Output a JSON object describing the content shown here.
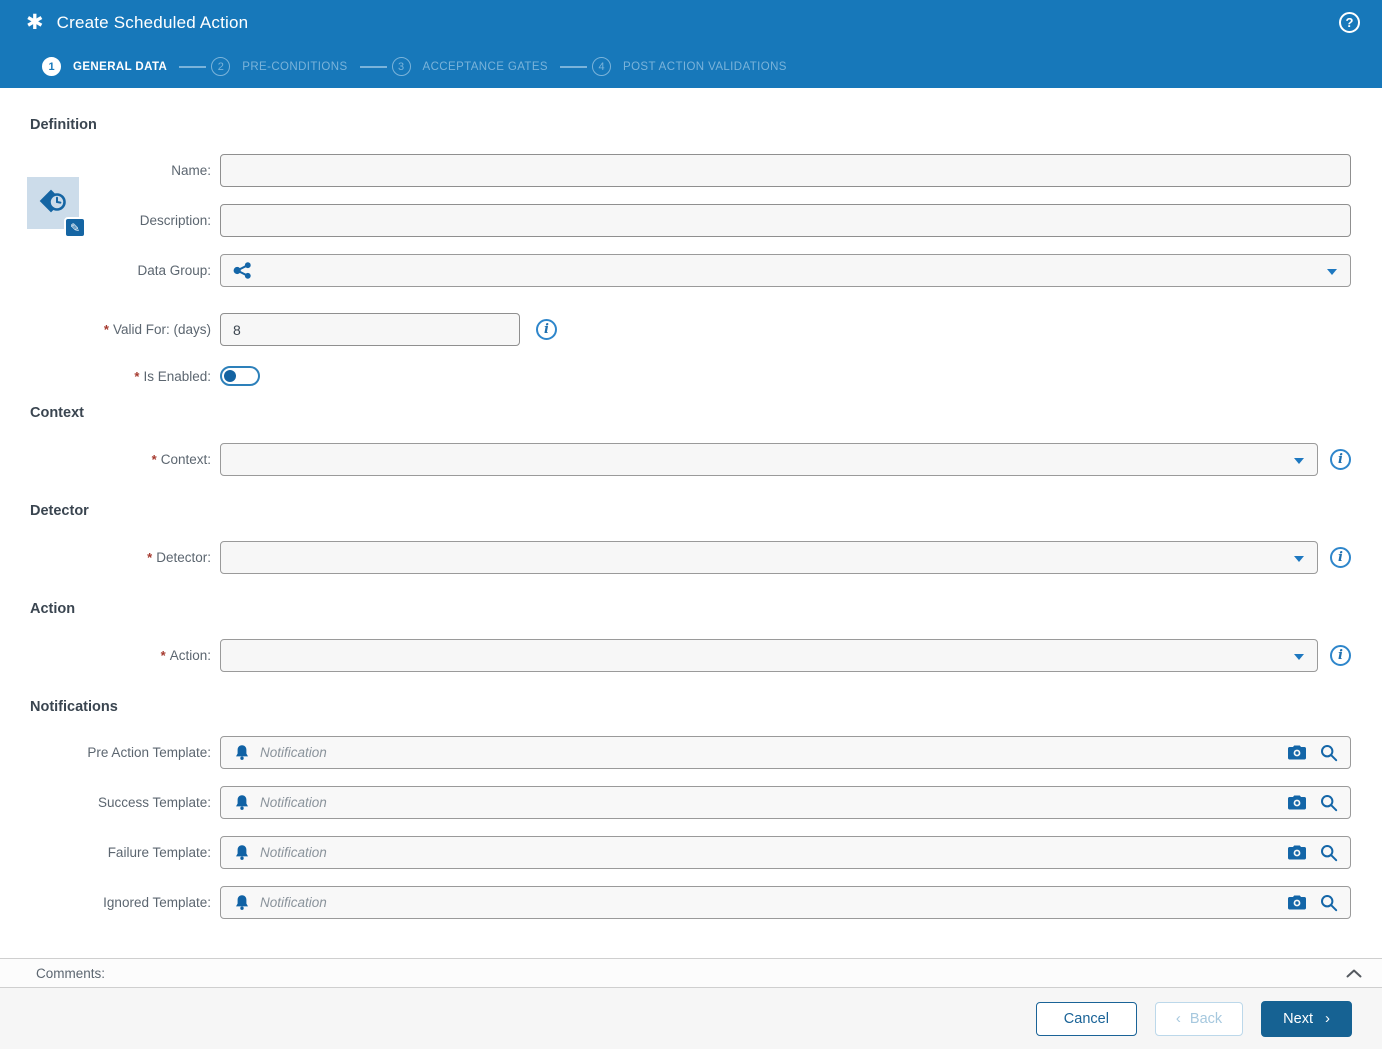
{
  "required_marker": "*",
  "header": {
    "app_icon_glyph": "✱",
    "title": "Create Scheduled Action",
    "help_glyph": "?"
  },
  "stepper": {
    "steps": [
      {
        "number": "1",
        "label": "GENERAL DATA"
      },
      {
        "number": "2",
        "label": "PRE-CONDITIONS"
      },
      {
        "number": "3",
        "label": "ACCEPTANCE GATES"
      },
      {
        "number": "4",
        "label": "POST ACTION VALIDATIONS"
      }
    ]
  },
  "definition": {
    "heading": "Definition",
    "name_label": "Name:",
    "name_value": "",
    "description_label": "Description:",
    "description_value": "",
    "data_group_label": "Data Group:",
    "valid_for_label": "Valid For: (days)",
    "valid_for_value": "8",
    "is_enabled_label": "Is Enabled:"
  },
  "context": {
    "heading": "Context",
    "label": "Context:"
  },
  "detector": {
    "heading": "Detector",
    "label": "Detector:"
  },
  "action": {
    "heading": "Action",
    "label": "Action:"
  },
  "notifications": {
    "heading": "Notifications",
    "rows": [
      {
        "label": "Pre Action Template:",
        "placeholder": "Notification"
      },
      {
        "label": "Success Template:",
        "placeholder": "Notification"
      },
      {
        "label": "Failure Template:",
        "placeholder": "Notification"
      },
      {
        "label": "Ignored Template:",
        "placeholder": "Notification"
      }
    ]
  },
  "comments": {
    "label": "Comments:"
  },
  "footer": {
    "cancel_label": "Cancel",
    "back_chevron": "‹",
    "back_label": "Back",
    "next_label": "Next",
    "next_chevron": "›"
  },
  "colors": {
    "header_blue": "#1778ba",
    "accent_dark_blue": "#1466a8",
    "caret_blue": "#1e78c0",
    "info_blue": "#2e86cb",
    "button_blue": "#166293",
    "inactive_step": "#7ab3da",
    "required_red": "#a5392e",
    "field_bg": "#f7f7f7"
  }
}
